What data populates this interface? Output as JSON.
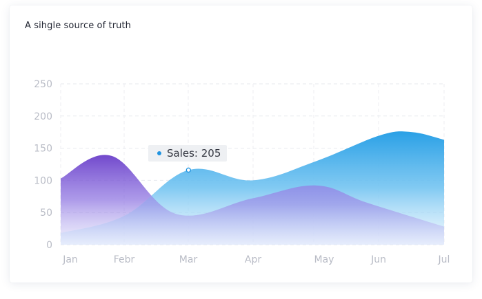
{
  "chart_data": {
    "type": "area",
    "title": "A sihgle source of truth",
    "categories": [
      "Jan",
      "Febr",
      "Mar",
      "Apr",
      "May",
      "Jun",
      "Jul"
    ],
    "ylim": [
      0,
      250
    ],
    "yticks": [
      0,
      50,
      100,
      150,
      200,
      250
    ],
    "grid": true,
    "series": [
      {
        "color": "#7b55d2",
        "x": [
          0,
          0.8,
          1.8,
          3.0,
          4.0,
          4.8,
          6.0
        ],
        "values": [
          103,
          138,
          48,
          72,
          92,
          65,
          28
        ]
      },
      {
        "name": "Sales",
        "color": "#3aa8e8",
        "x": [
          0,
          1.0,
          2.0,
          3.0,
          4.0,
          5.0,
          5.5,
          6.0
        ],
        "values": [
          18,
          45,
          116,
          100,
          130,
          170,
          175,
          163
        ]
      }
    ],
    "tooltip": {
      "text": "Sales: 205",
      "category": "Mar",
      "dot_color": "#1f93e0"
    }
  }
}
